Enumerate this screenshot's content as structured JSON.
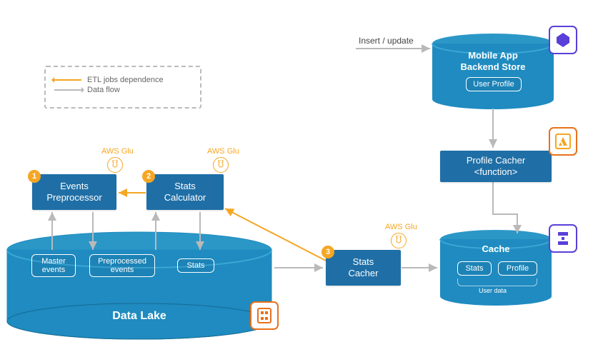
{
  "legend": {
    "dep": "ETL jobs dependence",
    "flow": "Data flow"
  },
  "boxes": {
    "preprocessor": "Events\nPreprocessor",
    "statscalc": "Stats\nCalculator",
    "statscacher": "Stats\nCacher",
    "profilecacher": "Profile Cacher\n<function>"
  },
  "insert_label": "Insert / update",
  "backend": {
    "title": "Mobile App\nBackend Store",
    "userprofile": "User Profile"
  },
  "cache": {
    "title": "Cache",
    "stats": "Stats",
    "profile": "Profile",
    "userdata": "User data"
  },
  "datalake": {
    "title": "Data Lake",
    "master": "Master\nevents",
    "preprocessed": "Preprocessed\nevents",
    "stats": "Stats"
  },
  "glue": "AWS Glu",
  "nums": {
    "a": "1",
    "b": "2",
    "c": "3"
  }
}
